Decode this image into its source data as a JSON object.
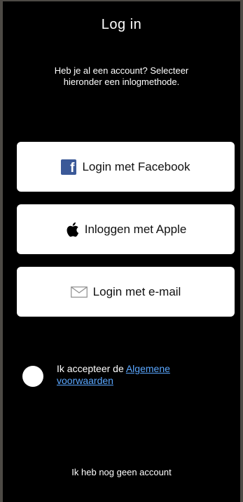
{
  "header": {
    "title": "Log in",
    "subtitle": "Heb je al een account? Selecteer hieronder een inlogmethode."
  },
  "buttons": {
    "facebook": {
      "label": "Login met Facebook",
      "icon": "facebook-icon"
    },
    "apple": {
      "label": "Inloggen met Apple",
      "icon": "apple-icon"
    },
    "email": {
      "label": "Login met e-mail",
      "icon": "envelope-icon"
    }
  },
  "terms": {
    "prefix": "Ik accepteer de ",
    "link": "Algemene voorwaarden",
    "checked": false
  },
  "footer": {
    "no_account": "Ik heb nog geen account"
  },
  "colors": {
    "background": "#000000",
    "frame": "#4d4a45",
    "button": "#ffffff",
    "facebook": "#3b5998",
    "link": "#5aa7ff"
  }
}
